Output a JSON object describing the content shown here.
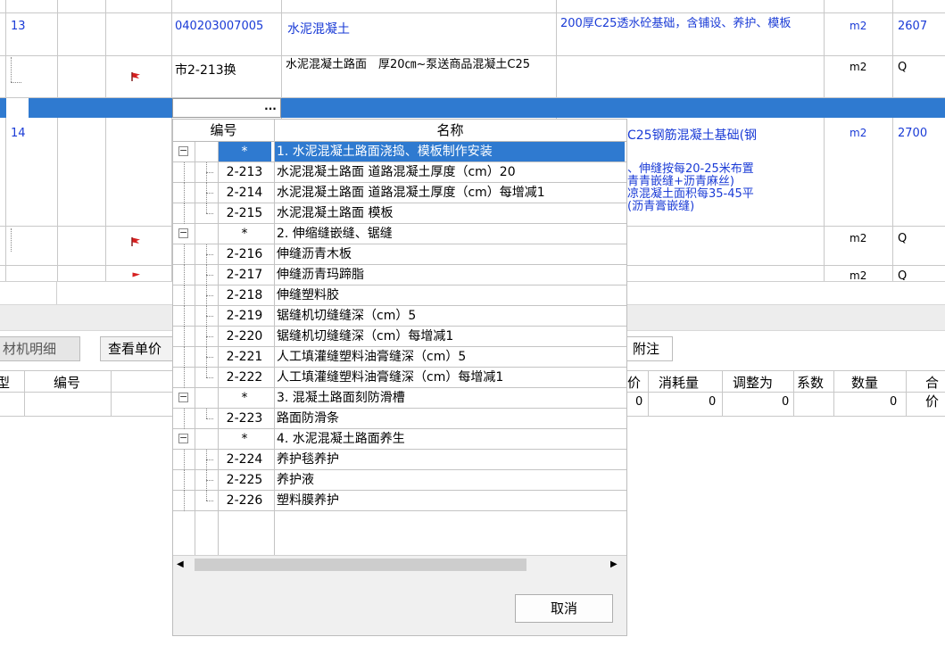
{
  "main_table": {
    "rows": [
      {
        "index": "13",
        "code": "040203007005",
        "name": "水泥混凝土",
        "feature": "200厚C25透水砼基础，含铺设、养护、模板",
        "unit": "m2",
        "qty": "2607"
      },
      {
        "code": "市2-213换",
        "name": "水泥混凝土路面　厚20㎝~泵送商品混凝土C25",
        "unit": "m2",
        "qty": "Q"
      },
      {
        "code_button": "...",
        "selected": true
      },
      {
        "index": "14",
        "feature_line1": "C25钢筋混凝土基础(钢",
        "feature_line2": "、伸缝按每20-25米布置",
        "feature_line3": "青青嵌缝+沥青麻丝)",
        "feature_line4": "凉混凝土面积每35-45平",
        "feature_line5": "(沥青膏嵌缝)",
        "unit": "m2",
        "qty": "2700"
      },
      {
        "unit": "m2",
        "qty": "Q"
      },
      {
        "unit": "m2",
        "qty": "Q"
      }
    ]
  },
  "lower_panel": {
    "tab_label": "材机明细",
    "view_button": "查看单价",
    "note_tab": "附注",
    "columns_left": [
      "型",
      "编号"
    ],
    "columns_right": [
      "价",
      "消耗量",
      "调整为",
      "系数",
      "数量",
      "合价"
    ],
    "values_right": [
      "0",
      "0",
      "0",
      "",
      "0",
      ""
    ]
  },
  "dropdown": {
    "header": {
      "code": "编号",
      "name": "名称"
    },
    "rows": [
      {
        "group": true,
        "code": "*",
        "name": "1. 水泥混凝土路面浇捣、模板制作安装",
        "selected": true
      },
      {
        "code": "2-213",
        "name": "水泥混凝土路面 道路混凝土厚度（cm）20"
      },
      {
        "code": "2-214",
        "name": "水泥混凝土路面 道路混凝土厚度（cm）每增减1"
      },
      {
        "code": "2-215",
        "name": "水泥混凝土路面 模板"
      },
      {
        "group": true,
        "code": "*",
        "name": "2. 伸缩缝嵌缝、锯缝"
      },
      {
        "code": "2-216",
        "name": "伸缝沥青木板"
      },
      {
        "code": "2-217",
        "name": "伸缝沥青玛蹄脂"
      },
      {
        "code": "2-218",
        "name": "伸缝塑料胶"
      },
      {
        "code": "2-219",
        "name": "锯缝机切缝缝深（cm）5"
      },
      {
        "code": "2-220",
        "name": "锯缝机切缝缝深（cm）每增减1"
      },
      {
        "code": "2-221",
        "name": "人工填灌缝塑料油膏缝深（cm）5"
      },
      {
        "code": "2-222",
        "name": "人工填灌缝塑料油膏缝深（cm）每增减1"
      },
      {
        "group": true,
        "code": "*",
        "name": "3. 混凝土路面刻防滑槽"
      },
      {
        "code": "2-223",
        "name": "路面防滑条"
      },
      {
        "group": true,
        "code": "*",
        "name": "4. 水泥混凝土路面养生"
      },
      {
        "code": "2-224",
        "name": "养护毯养护"
      },
      {
        "code": "2-225",
        "name": "养护液"
      },
      {
        "code": "2-226",
        "name": "塑料膜养护"
      }
    ],
    "cancel_label": "取消"
  },
  "icons": {
    "expander_open": "minus-box-icon",
    "flag": "red-flag-icon",
    "scroll_left": "scroll-left-icon",
    "scroll_right": "scroll-right-icon"
  },
  "colors": {
    "selection": "#2f7ad0",
    "link_text": "#1a3bd6",
    "flag": "#d62020"
  }
}
